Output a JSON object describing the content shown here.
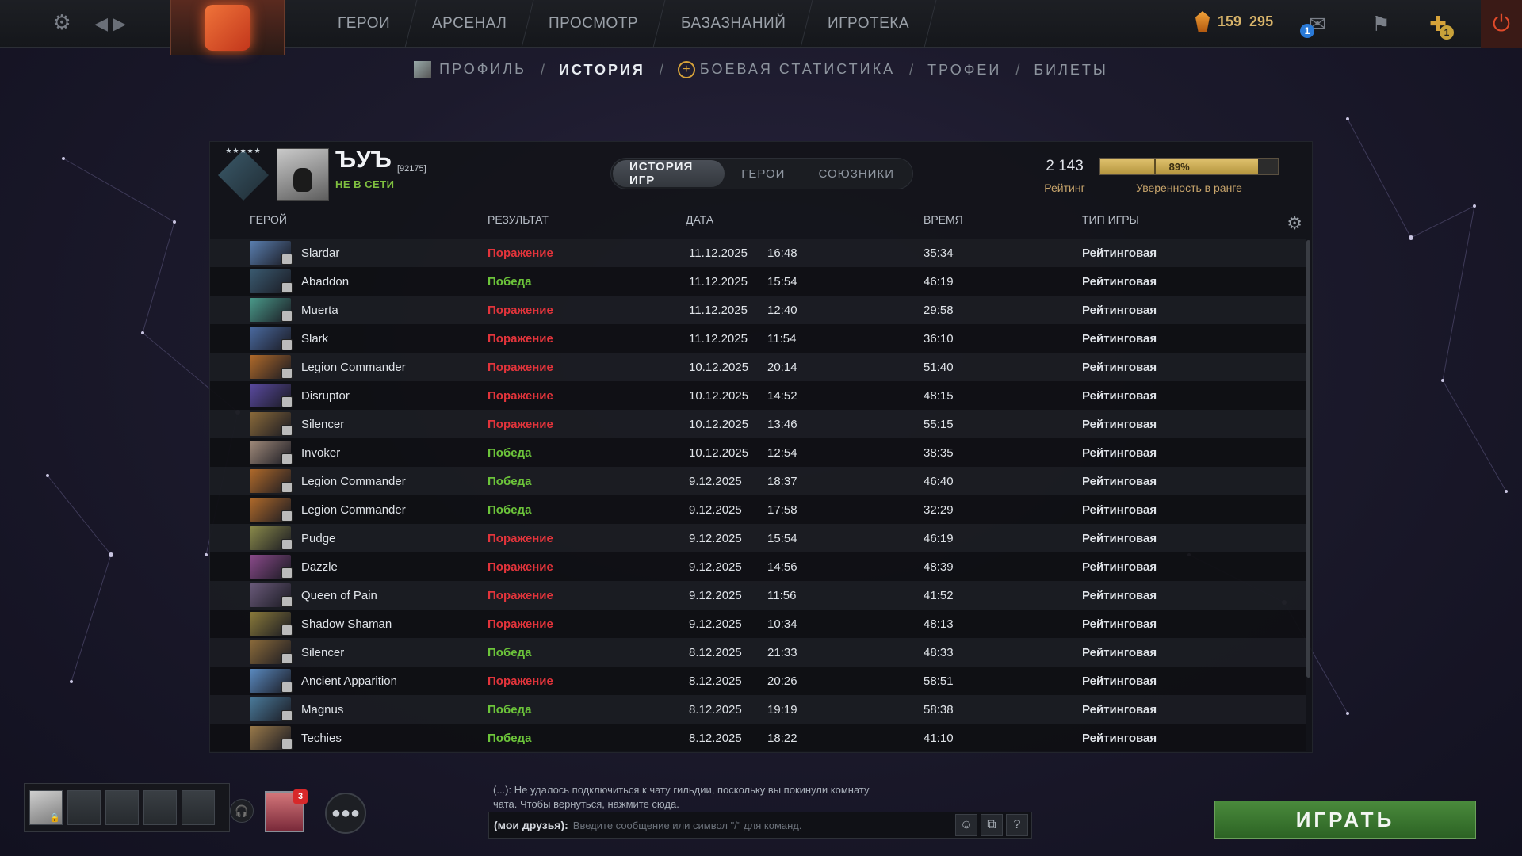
{
  "topbar": {
    "nav": [
      "ГЕРОИ",
      "АРСЕНАЛ",
      "ПРОСМОТР",
      "БАЗАЗНАНИЙ",
      "ИГРОТЕКА"
    ],
    "currency_1": "159",
    "currency_2": "295",
    "messages_count": "1",
    "plus_count": "1"
  },
  "subnav": {
    "profile": "ПРОФИЛЬ",
    "history": "ИСТОРИЯ",
    "stats": "БОЕВАЯ СТАТИСТИКА",
    "trophies": "ТРОФЕИ",
    "tickets": "БИЛЕТЫ",
    "separator": "/"
  },
  "player": {
    "name": "ЪУЪ",
    "id": "[92175]",
    "status": "НЕ В СЕТИ"
  },
  "tabs": [
    "ИСТОРИЯ ИГР",
    "ГЕРОИ",
    "СОЮЗНИКИ"
  ],
  "rating": {
    "value": "2 143",
    "label": "Рейтинг",
    "confidence_text": "89%",
    "confidence_fraction": 0.89,
    "confidence_label": "Уверенность в ранге"
  },
  "columns": {
    "hero": "ГЕРОЙ",
    "result": "РЕЗУЛЬТАТ",
    "date": "ДАТА",
    "time": "ВРЕМЯ",
    "type": "ТИП ИГРЫ"
  },
  "matches": [
    {
      "hero": "Slardar",
      "result": "Поражение",
      "win": false,
      "date": "11.12.2025",
      "start": "16:48",
      "duration": "35:34",
      "type": "Рейтинговая",
      "color": "#5a7fb0"
    },
    {
      "hero": "Abaddon",
      "result": "Победа",
      "win": true,
      "date": "11.12.2025",
      "start": "15:54",
      "duration": "46:19",
      "type": "Рейтинговая",
      "color": "#3a5a70"
    },
    {
      "hero": "Muerta",
      "result": "Поражение",
      "win": false,
      "date": "11.12.2025",
      "start": "12:40",
      "duration": "29:58",
      "type": "Рейтинговая",
      "color": "#4a9a8a"
    },
    {
      "hero": "Slark",
      "result": "Поражение",
      "win": false,
      "date": "11.12.2025",
      "start": "11:54",
      "duration": "36:10",
      "type": "Рейтинговая",
      "color": "#4a6aa0"
    },
    {
      "hero": "Legion Commander",
      "result": "Поражение",
      "win": false,
      "date": "10.12.2025",
      "start": "20:14",
      "duration": "51:40",
      "type": "Рейтинговая",
      "color": "#b06a2a"
    },
    {
      "hero": "Disruptor",
      "result": "Поражение",
      "win": false,
      "date": "10.12.2025",
      "start": "14:52",
      "duration": "48:15",
      "type": "Рейтинговая",
      "color": "#5a4aa0"
    },
    {
      "hero": "Silencer",
      "result": "Поражение",
      "win": false,
      "date": "10.12.2025",
      "start": "13:46",
      "duration": "55:15",
      "type": "Рейтинговая",
      "color": "#8a6a3a"
    },
    {
      "hero": "Invoker",
      "result": "Победа",
      "win": true,
      "date": "10.12.2025",
      "start": "12:54",
      "duration": "38:35",
      "type": "Рейтинговая",
      "color": "#a08a7a"
    },
    {
      "hero": "Legion Commander",
      "result": "Победа",
      "win": true,
      "date": "9.12.2025",
      "start": "18:37",
      "duration": "46:40",
      "type": "Рейтинговая",
      "color": "#b06a2a"
    },
    {
      "hero": "Legion Commander",
      "result": "Победа",
      "win": true,
      "date": "9.12.2025",
      "start": "17:58",
      "duration": "32:29",
      "type": "Рейтинговая",
      "color": "#b06a2a"
    },
    {
      "hero": "Pudge",
      "result": "Поражение",
      "win": false,
      "date": "9.12.2025",
      "start": "15:54",
      "duration": "46:19",
      "type": "Рейтинговая",
      "color": "#8a8a4a"
    },
    {
      "hero": "Dazzle",
      "result": "Поражение",
      "win": false,
      "date": "9.12.2025",
      "start": "14:56",
      "duration": "48:39",
      "type": "Рейтинговая",
      "color": "#8a4a8a"
    },
    {
      "hero": "Queen of Pain",
      "result": "Поражение",
      "win": false,
      "date": "9.12.2025",
      "start": "11:56",
      "duration": "41:52",
      "type": "Рейтинговая",
      "color": "#6a5a7a"
    },
    {
      "hero": "Shadow Shaman",
      "result": "Поражение",
      "win": false,
      "date": "9.12.2025",
      "start": "10:34",
      "duration": "48:13",
      "type": "Рейтинговая",
      "color": "#8a7a3a"
    },
    {
      "hero": "Silencer",
      "result": "Победа",
      "win": true,
      "date": "8.12.2025",
      "start": "21:33",
      "duration": "48:33",
      "type": "Рейтинговая",
      "color": "#8a6a3a"
    },
    {
      "hero": "Ancient Apparition",
      "result": "Поражение",
      "win": false,
      "date": "8.12.2025",
      "start": "20:26",
      "duration": "58:51",
      "type": "Рейтинговая",
      "color": "#5a8ac0"
    },
    {
      "hero": "Magnus",
      "result": "Победа",
      "win": true,
      "date": "8.12.2025",
      "start": "19:19",
      "duration": "58:38",
      "type": "Рейтинговая",
      "color": "#4a7a9a"
    },
    {
      "hero": "Techies",
      "result": "Победа",
      "win": true,
      "date": "8.12.2025",
      "start": "18:22",
      "duration": "41:10",
      "type": "Рейтинговая",
      "color": "#9a7a4a"
    }
  ],
  "bottom": {
    "friend_notifications": "3",
    "chat_notice": "(...): Не удалось подключиться к чату гильдии, поскольку вы покинули комнату чата. Чтобы вернуться, нажмите сюда.",
    "chat_channel": "(мои друзья):",
    "chat_placeholder": "Введите сообщение или символ \"/\" для команд.",
    "help": "?",
    "play": "ИГРАТЬ"
  }
}
